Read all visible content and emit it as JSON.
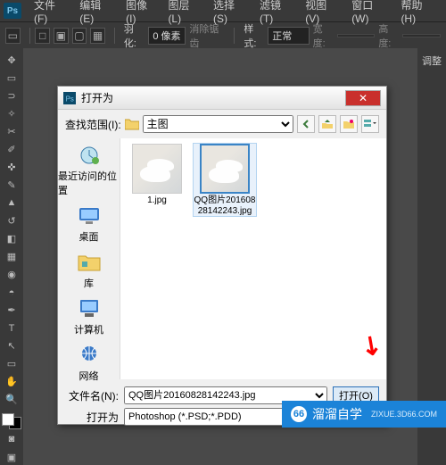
{
  "menubar": {
    "items": [
      {
        "label": "文件(F)"
      },
      {
        "label": "编辑(E)"
      },
      {
        "label": "图像(I)"
      },
      {
        "label": "图层(L)"
      },
      {
        "label": "选择(S)"
      },
      {
        "label": "滤镜(T)"
      },
      {
        "label": "视图(V)"
      },
      {
        "label": "窗口(W)"
      },
      {
        "label": "帮助(H)"
      }
    ],
    "logo": "Ps"
  },
  "optbar": {
    "feather_label": "羽化:",
    "feather_value": "0 像素",
    "antialias_label": "消除锯齿",
    "style_label": "样式:",
    "style_value": "正常",
    "width_label": "宽度:",
    "height_label": "高度:"
  },
  "panel": {
    "adjust_label": "调整"
  },
  "dialog": {
    "title": "打开为",
    "lookin_label": "查找范围(I):",
    "lookin_value": "主图",
    "places": {
      "recent": "最近访问的位置",
      "desktop": "桌面",
      "libraries": "库",
      "computer": "计算机",
      "network": "网络"
    },
    "files": [
      {
        "name": "1.jpg",
        "selected": false
      },
      {
        "name": "QQ图片20160828142243.jpg",
        "selected": true
      }
    ],
    "filename_label": "文件名(N):",
    "filename_value": "QQ图片20160828142243.jpg",
    "openas_label": "打开为",
    "openas_value": "Photoshop (*.PSD;*.PDD)",
    "open_button": "打开(O)"
  },
  "watermark": {
    "brand": "溜溜自学",
    "sub": "ZIXUE.3D66.COM"
  }
}
